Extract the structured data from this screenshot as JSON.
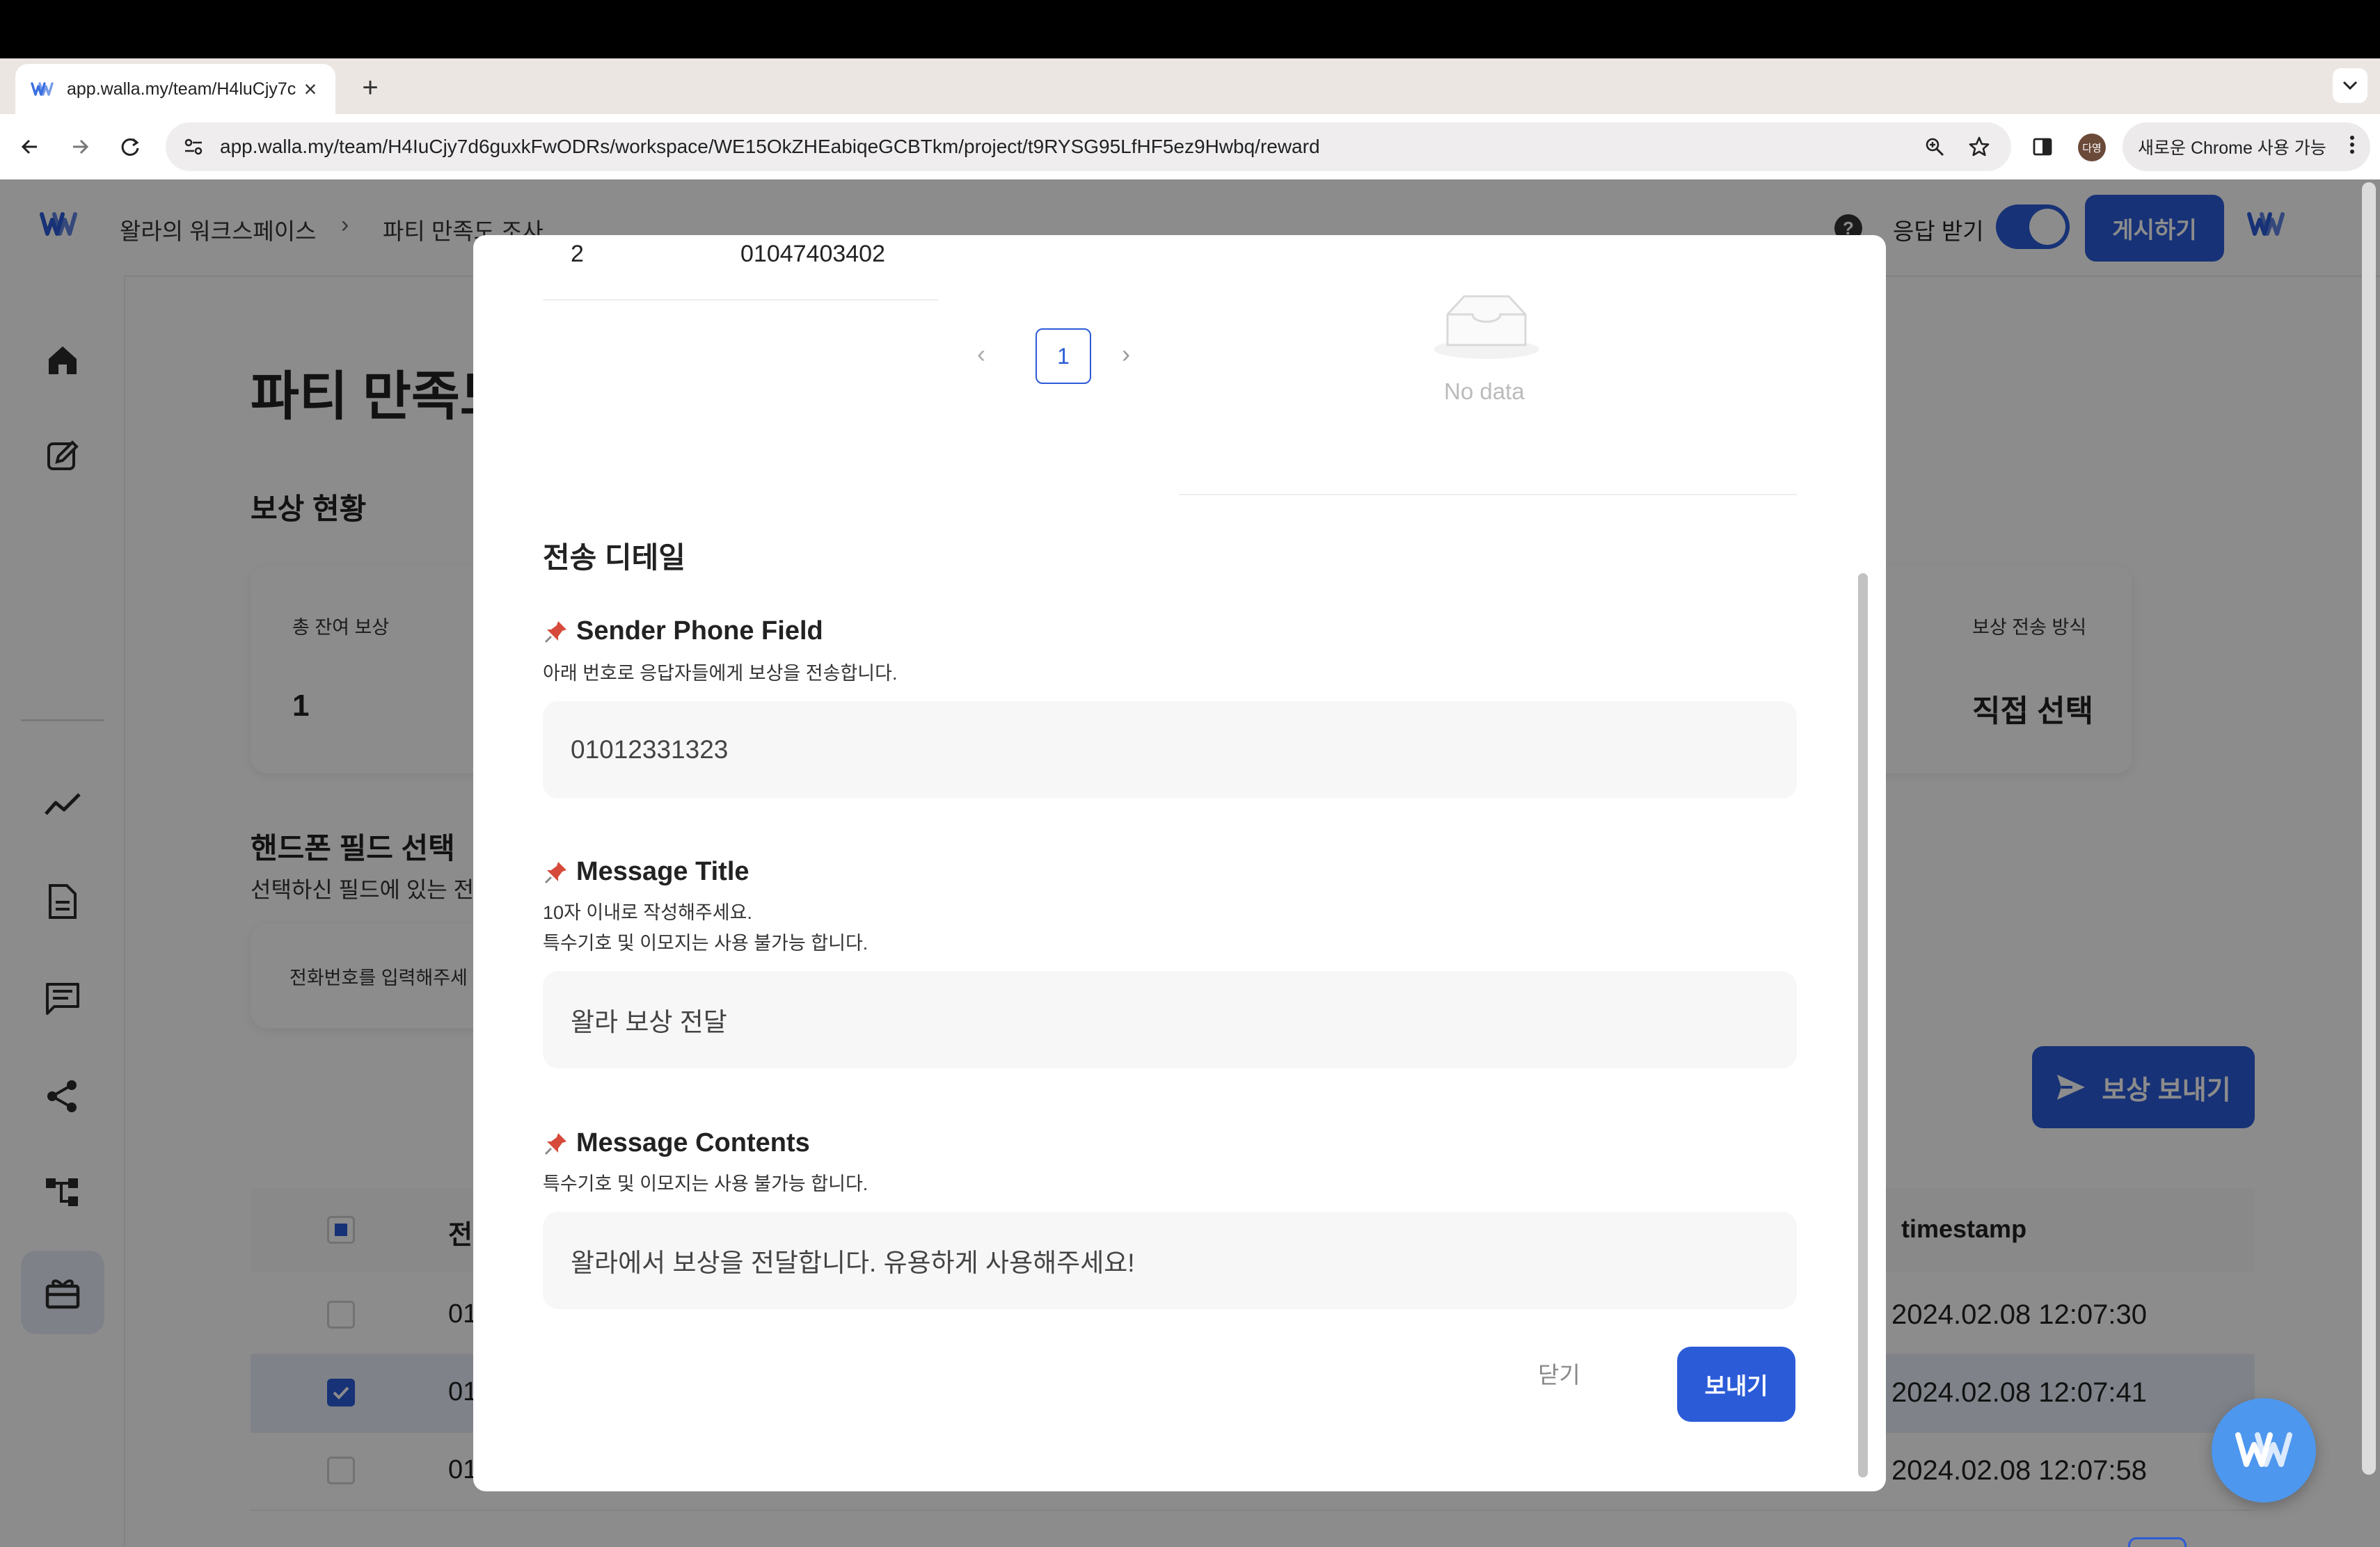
{
  "browser": {
    "tab_title": "app.walla.my/team/H4luCjy7c",
    "url": "app.walla.my/team/H4IuCjy7d6guxkFwODRs/workspace/WE15OkZHEabiqeGCBTkm/project/t9RYSG95LfHF5ez9Hwbq/reward",
    "profile_initials": "다영",
    "chrome_notice": "새로운 Chrome 사용 가능",
    "icons": [
      "back-icon",
      "forward-icon",
      "reload-icon",
      "site-settings-icon",
      "zoom-icon",
      "star-icon",
      "side-panel-icon",
      "kebab-icon"
    ]
  },
  "header": {
    "workspace": "왈라의 워크스페이스",
    "separator": "›",
    "project": "파티 만족도 조사",
    "response_label": "응답 받기",
    "response_enabled": true,
    "publish_label": "게시하기",
    "help_label": "?"
  },
  "sidebar": {
    "items": [
      {
        "icon": "home-icon",
        "active": false
      },
      {
        "icon": "edit-icon",
        "active": false
      },
      {
        "icon": "analytics-icon",
        "active": false
      },
      {
        "icon": "document-icon",
        "active": false
      },
      {
        "icon": "message-icon",
        "active": false
      },
      {
        "icon": "share-icon",
        "active": false
      },
      {
        "icon": "flow-icon",
        "active": false
      },
      {
        "icon": "gift-icon",
        "active": true
      }
    ]
  },
  "page": {
    "title": "파티 만족도",
    "reward_status_title": "보상 현황",
    "remaining_label": "총 잔여 보상",
    "remaining_value": "1",
    "delivery_method_label": "보상 전송 방식",
    "delivery_method_value": "직접 선택",
    "phone_field_title": "핸드폰 필드 선택",
    "phone_field_desc": "선택하신 필드에 있는 전",
    "phone_field_placeholder": "전화번호를 입력해주세",
    "send_reward_button": "보상 보내기",
    "table": {
      "col_phone_partial": "전",
      "col_timestamp": "timestamp",
      "rows": [
        {
          "phone": "01",
          "timestamp": "2024.02.08 12:07:30",
          "checked": false
        },
        {
          "phone": "01",
          "timestamp": "2024.02.08 12:07:41",
          "checked": true
        },
        {
          "phone": "01",
          "timestamp": "2024.02.08 12:07:58",
          "checked": false
        }
      ]
    }
  },
  "modal": {
    "list_row": {
      "index": "2",
      "phone": "01047403402"
    },
    "pagination": {
      "prev": "‹",
      "current": "1",
      "next": "›"
    },
    "no_data_text": "No data",
    "section_title": "전송 디테일",
    "sender": {
      "title": "Sender Phone Field",
      "help": "아래 번호로 응답자들에게 보상을 전송합니다.",
      "value": "01012331323"
    },
    "message_title": {
      "title": "Message Title",
      "help_line1": "10자 이내로 작성해주세요.",
      "help_line2": "특수기호 및 이모지는 사용 불가능 합니다.",
      "value": "왈라 보상 전달"
    },
    "message_contents": {
      "title": "Message Contents",
      "help": "특수기호 및 이모지는 사용 불가능 합니다.",
      "value": "왈라에서 보상을 전달합니다. 유용하게 사용해주세요!"
    },
    "close_label": "닫기",
    "send_label": "보내기"
  },
  "colors": {
    "primary": "#2b5bd7",
    "fab": "#4d97ee",
    "pin": "#d64a3b"
  }
}
